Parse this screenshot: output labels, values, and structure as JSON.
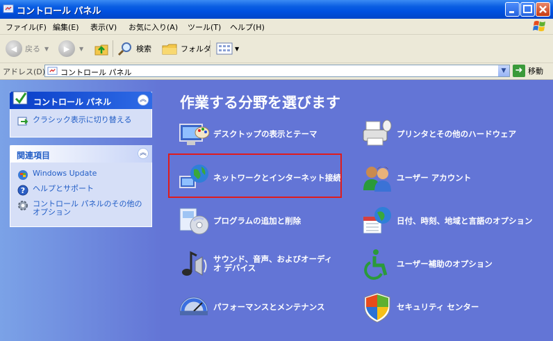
{
  "window": {
    "title": "コントロール パネル"
  },
  "menu": [
    "ファイル(F)",
    "編集(E)",
    "表示(V)",
    "お気に入り(A)",
    "ツール(T)",
    "ヘルプ(H)"
  ],
  "toolbar": {
    "back": "戻る",
    "search": "検索",
    "folders": "フォルダ"
  },
  "address": {
    "label": "アドレス(D)",
    "value": "コントロール パネル",
    "go": "移動"
  },
  "left": {
    "cp_panel": {
      "title": "コントロール パネル",
      "links": [
        "クラシック表示に切り替える"
      ]
    },
    "related": {
      "title": "関連項目",
      "links": [
        "Windows Update",
        "ヘルプとサポート",
        "コントロール パネルのその他のオプション"
      ]
    }
  },
  "main": {
    "heading": "作業する分野を選びます",
    "categories": [
      {
        "label": "デスクトップの表示とテーマ",
        "icon": "display-icon"
      },
      {
        "label": "ネットワークとインターネット接続",
        "icon": "network-icon"
      },
      {
        "label": "プログラムの追加と削除",
        "icon": "programs-icon"
      },
      {
        "label": "サウンド、音声、およびオーディオ デバイス",
        "icon": "sound-icon"
      },
      {
        "label": "パフォーマンスとメンテナンス",
        "icon": "performance-icon"
      },
      {
        "label": "プリンタとその他のハードウェア",
        "icon": "printer-icon"
      },
      {
        "label": "ユーザー アカウント",
        "icon": "users-icon"
      },
      {
        "label": "日付、時刻、地域と言語のオプション",
        "icon": "datetime-icon"
      },
      {
        "label": "ユーザー補助のオプション",
        "icon": "accessibility-icon"
      },
      {
        "label": "セキュリティ センター",
        "icon": "shield-icon"
      }
    ]
  },
  "colors": {
    "highlight_box": "#e01b1b",
    "main_bg": "#6375d6",
    "title_blue": "#0050e0"
  }
}
